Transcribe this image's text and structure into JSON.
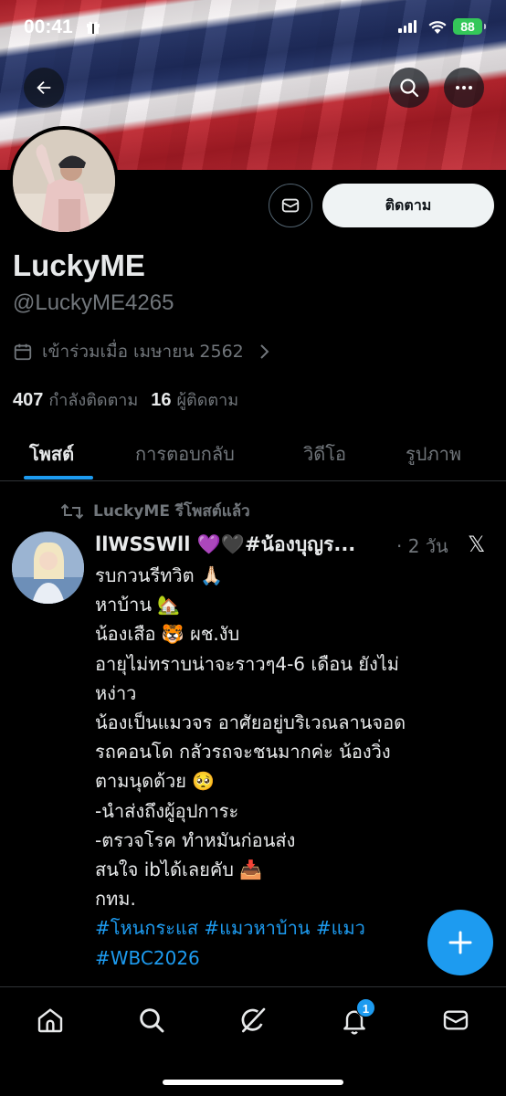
{
  "status_bar": {
    "time": "00:41",
    "battery": "88"
  },
  "header": {
    "back_icon": "arrow-left-icon",
    "search_icon": "search-icon",
    "more_icon": "more-icon"
  },
  "profile": {
    "display_name": "LuckyME",
    "handle": "@LuckyME4265",
    "joined": "เข้าร่วมเมื่อ เมษายน 2562",
    "following_count": "407",
    "following_label": "กำลังติดตาม",
    "followers_count": "16",
    "followers_label": "ผู้ติดตาม",
    "follow_button": "ติดตาม",
    "message_icon": "envelope-icon"
  },
  "tabs": [
    {
      "label": "โพสต์",
      "active": true
    },
    {
      "label": "การตอบกลับ",
      "active": false
    },
    {
      "label": "วิดีโอ",
      "active": false
    },
    {
      "label": "รูปภาพ",
      "active": false
    }
  ],
  "tweet": {
    "repost_label": "LuckyME รีโพสต์แล้ว",
    "author_name": "llWSSWll 💜🖤#น้องบุญร...",
    "time": "· 2 วัน",
    "body_lines": [
      "รบกวนรีทวิต 🙏🏻",
      "หาบ้าน 🏡",
      "น้องเสือ 🐯 ผช.งับ",
      "อายุไม่ทราบน่าจะราวๆ4-6 เดือน ยังไม่",
      "หง่าว",
      "น้องเป็นแมวจร อาศัยอยู่บริเวณลานจอด",
      "รถคอนโด กลัวรถจะชนมากค่ะ น้องวิ่ง",
      "ตามนุดด้วย 🥺",
      "-นำส่งถึงผู้อุปการะ",
      "-ตรวจโรค ทำหมันก่อนส่ง",
      "สนใจ ibได้เลยคับ 📥",
      "กทม."
    ],
    "hashtags_line1": "#โหนกระแส #แมวหาบ้าน #แมว",
    "hashtags_line2": "#WBC2026"
  },
  "fab": {
    "icon": "plus-icon"
  },
  "bottom_nav": {
    "items": [
      "home-icon",
      "search-icon",
      "grok-icon",
      "bell-icon",
      "envelope-icon"
    ],
    "notification_badge": "1"
  },
  "colors": {
    "accent": "#1d9bf0",
    "background": "#000000",
    "text": "#e7e9ea",
    "muted": "#71767b",
    "battery": "#34c759"
  }
}
